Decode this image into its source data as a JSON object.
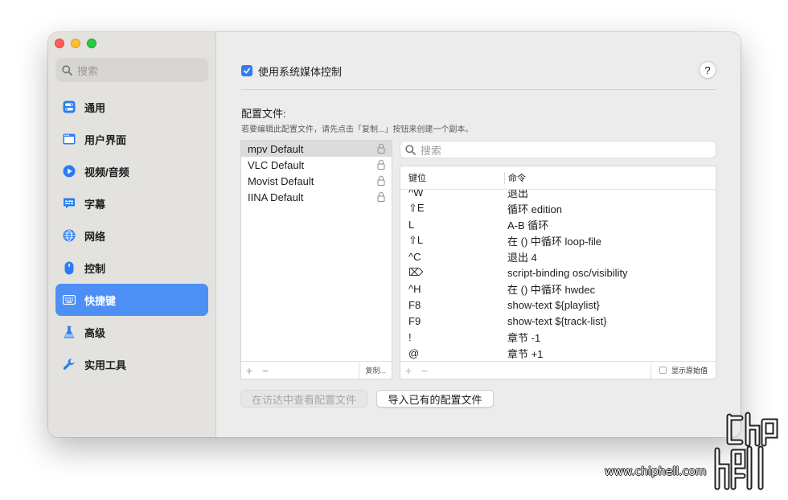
{
  "sidebar": {
    "search_placeholder": "搜索",
    "items": [
      {
        "label": "通用",
        "icon": "toggle-icon",
        "color": "#2b7cf4"
      },
      {
        "label": "用户界面",
        "icon": "window-icon",
        "color": "#2b7cf4"
      },
      {
        "label": "视频/音频",
        "icon": "play-icon",
        "color": "#2b7cf4"
      },
      {
        "label": "字幕",
        "icon": "caption-icon",
        "color": "#2b7cf4"
      },
      {
        "label": "网络",
        "icon": "globe-icon",
        "color": "#2b7cf4"
      },
      {
        "label": "控制",
        "icon": "mouse-icon",
        "color": "#2b7cf4"
      },
      {
        "label": "快捷键",
        "icon": "keyboard-icon",
        "color": "#ffffff",
        "active": true
      },
      {
        "label": "高级",
        "icon": "flask-icon",
        "color": "#2b7cf4"
      },
      {
        "label": "实用工具",
        "icon": "wrench-icon",
        "color": "#2b7cf4"
      }
    ]
  },
  "main": {
    "media_control_label": "使用系统媒体控制",
    "media_control_checked": true,
    "help_label": "?",
    "config_title": "配置文件:",
    "config_hint": "若要编辑此配置文件，请先点击「复制...」按钮来创建一个副本。",
    "profiles": [
      "mpv Default",
      "VLC Default",
      "Movist Default",
      "IINA Default"
    ],
    "selected_profile": "mpv Default",
    "profiles_footer": {
      "add": "+",
      "remove": "−",
      "duplicate": "复制..."
    },
    "key_search_placeholder": "搜索",
    "table": {
      "col_key": "键位",
      "col_action": "命令",
      "rows": [
        {
          "key": "^W",
          "action": "退出"
        },
        {
          "key": "⇧E",
          "action": "循环 edition"
        },
        {
          "key": "L",
          "action": "A-B 循环"
        },
        {
          "key": "⇧L",
          "action": "在 () 中循环 loop-file"
        },
        {
          "key": "^C",
          "action": "退出 4"
        },
        {
          "key": "⌦",
          "action": "script-binding osc/visibility"
        },
        {
          "key": "^H",
          "action": "在 () 中循环 hwdec"
        },
        {
          "key": "F8",
          "action": "show-text ${playlist}"
        },
        {
          "key": "F9",
          "action": "show-text ${track-list}"
        },
        {
          "key": "!",
          "action": "章节 -1"
        },
        {
          "key": "@",
          "action": "章节 +1"
        }
      ],
      "footer_add": "+",
      "footer_remove": "−",
      "show_raw_label": "显示原始值"
    },
    "reveal_button": "在访达中查看配置文件",
    "import_button": "导入已有的配置文件"
  },
  "watermark": {
    "text": "www.chiphell.com"
  }
}
